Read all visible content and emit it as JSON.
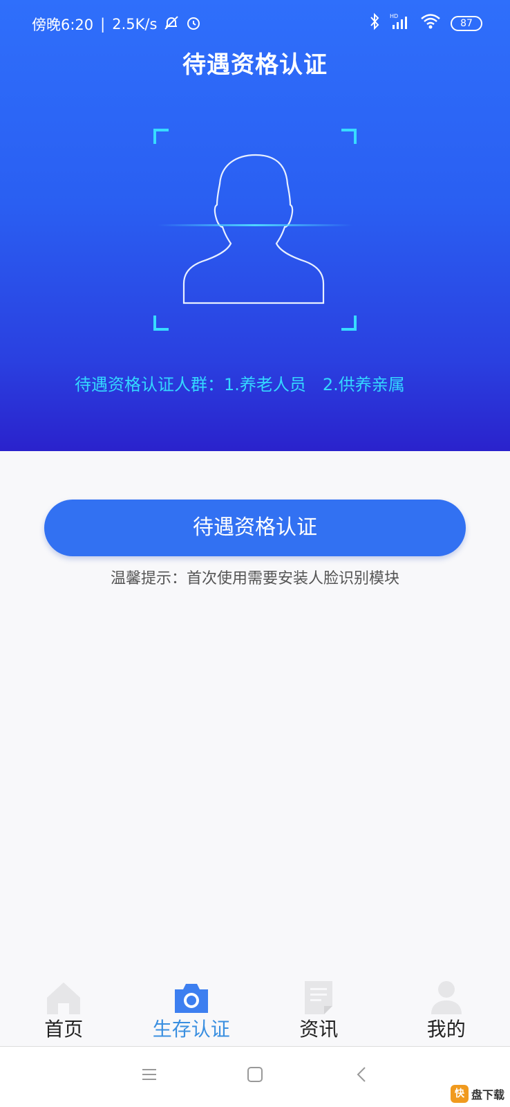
{
  "status_bar": {
    "time": "傍晚6:20",
    "network_speed": "2.5K/s",
    "battery": "87",
    "icons": [
      "mute-bell-icon",
      "alarm-icon",
      "bluetooth-icon",
      "hd-signal-icon",
      "wifi-icon",
      "battery-icon"
    ]
  },
  "header": {
    "title": "待遇资格认证"
  },
  "scan": {
    "crowd_text": "待遇资格认证人群：1.养老人员　2.供养亲属"
  },
  "main": {
    "button_label": "待遇资格认证",
    "tip": "温馨提示：首次使用需要安装人脸识别模块"
  },
  "tabs": [
    {
      "label": "首页",
      "icon": "home-icon",
      "active": false
    },
    {
      "label": "生存认证",
      "icon": "camera-icon",
      "active": true
    },
    {
      "label": "资讯",
      "icon": "document-icon",
      "active": false
    },
    {
      "label": "我的",
      "icon": "user-icon",
      "active": false
    }
  ],
  "watermark": {
    "badge": "快",
    "text": "盘下载"
  },
  "colors": {
    "accent": "#3271f2",
    "active_tab": "#3a8fe0",
    "crowd_text": "#34d8ff",
    "scan_line": "#4fd6ff",
    "watermark_badge": "#f09a1e"
  }
}
